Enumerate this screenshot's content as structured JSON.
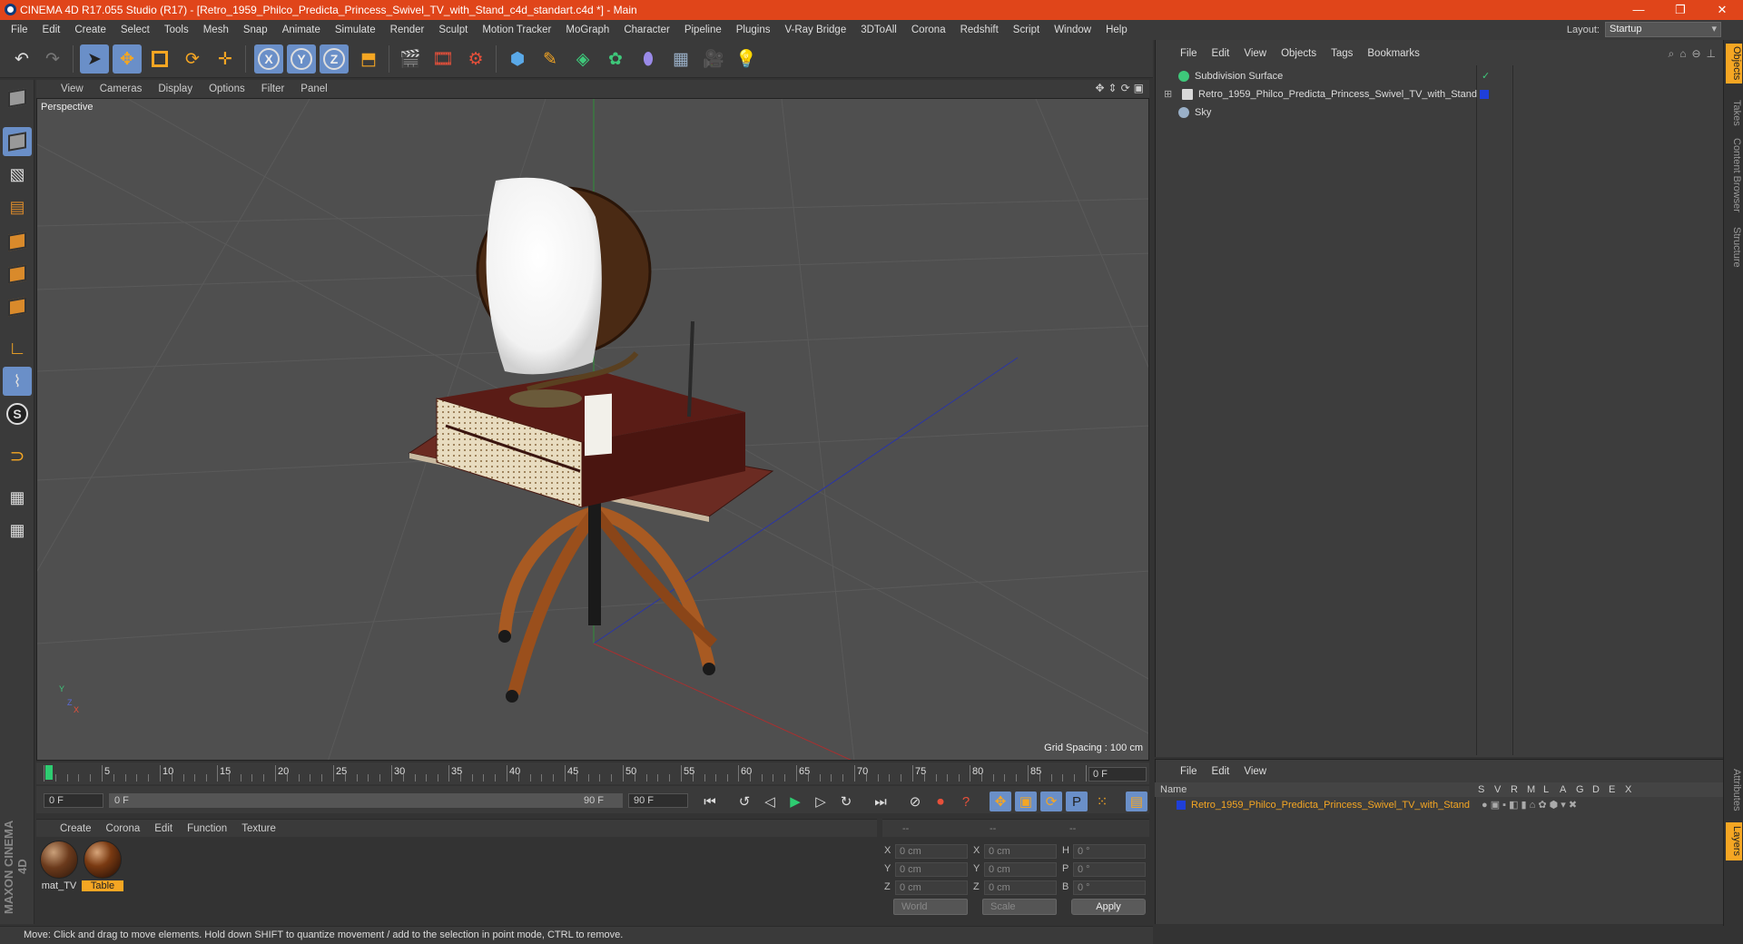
{
  "window": {
    "title": "CINEMA 4D R17.055 Studio (R17) - [Retro_1959_Philco_Predicta_Princess_Swivel_TV_with_Stand_c4d_standart.c4d *] - Main",
    "controls": {
      "minimize": "—",
      "restore": "❐",
      "close": "✕"
    }
  },
  "menubar": {
    "items": [
      "File",
      "Edit",
      "Create",
      "Select",
      "Tools",
      "Mesh",
      "Snap",
      "Animate",
      "Simulate",
      "Render",
      "Sculpt",
      "Motion Tracker",
      "MoGraph",
      "Character",
      "Pipeline",
      "Plugins",
      "V-Ray Bridge",
      "3DToAll",
      "Corona",
      "Redshift",
      "Script",
      "Window",
      "Help"
    ],
    "layout_label": "Layout:",
    "layout_value": "Startup"
  },
  "toolbar": {
    "icons": [
      "undo-icon",
      "redo-icon",
      "select-arrow-icon",
      "move-icon",
      "scale-icon",
      "rotate-icon",
      "live-select-icon",
      "x-axis-icon",
      "y-axis-icon",
      "z-axis-icon",
      "coordinate-system-icon",
      "render-view-icon",
      "render-picture-viewer-icon",
      "render-settings-icon",
      "cube-icon",
      "pen-spline-icon",
      "subdivision-icon",
      "cloner-icon",
      "deformer-icon",
      "floor-icon",
      "camera-icon",
      "light-icon"
    ],
    "axis_labels": [
      "X",
      "Y",
      "Z"
    ],
    "accent_color": "#6a8fc8"
  },
  "left_tools": {
    "icons": [
      "make-editable-icon",
      "model-mode-icon",
      "texture-mode-icon",
      "workplane-icon",
      "points-mode-icon",
      "edges-mode-icon",
      "polygons-mode-icon",
      "axis-mode-icon",
      "tweak-mode-icon",
      "snap-s-icon",
      "magnet-icon",
      "workplane-lock-icon",
      "solo-icon"
    ],
    "brand": "MAXON CINEMA 4D"
  },
  "viewport": {
    "menu": [
      "View",
      "Cameras",
      "Display",
      "Options",
      "Filter",
      "Panel"
    ],
    "label": "Perspective",
    "grid_spacing": "Grid Spacing : 100 cm",
    "axis_labels": {
      "y": "Y",
      "z": "Z",
      "x": "X"
    }
  },
  "timeline": {
    "ticks": [
      "0",
      "5",
      "10",
      "15",
      "20",
      "25",
      "30",
      "35",
      "40",
      "45",
      "50",
      "55",
      "60",
      "65",
      "70",
      "75",
      "80",
      "85",
      "90"
    ],
    "current_frame": "0 F",
    "start_field": "0 F",
    "range_start": "0 F",
    "range_end": "90 F",
    "end_field": "90 F"
  },
  "material_manager": {
    "menu": [
      "Create",
      "Corona",
      "Edit",
      "Function",
      "Texture"
    ],
    "materials": [
      {
        "name": "mat_TV",
        "selected": false
      },
      {
        "name": "Table",
        "selected": true
      }
    ]
  },
  "coordinates": {
    "headers": [
      "--",
      "--",
      "--"
    ],
    "rows": [
      {
        "a_label": "X",
        "a_value": "0 cm",
        "b_label": "X",
        "b_value": "0 cm",
        "c_label": "H",
        "c_value": "0 °"
      },
      {
        "a_label": "Y",
        "a_value": "0 cm",
        "b_label": "Y",
        "b_value": "0 cm",
        "c_label": "P",
        "c_value": "0 °"
      },
      {
        "a_label": "Z",
        "a_value": "0 cm",
        "b_label": "Z",
        "b_value": "0 cm",
        "c_label": "B",
        "c_value": "0 °"
      }
    ],
    "space_dropdown": "World",
    "mode_dropdown": "Scale",
    "apply_label": "Apply"
  },
  "status_bar": {
    "text": "Move: Click and drag to move elements. Hold down SHIFT to quantize movement / add to the selection in point mode, CTRL to remove."
  },
  "object_manager": {
    "menu": [
      "File",
      "Edit",
      "View",
      "Objects",
      "Tags",
      "Bookmarks"
    ],
    "objects": [
      {
        "name": "Subdivision Surface",
        "icon_color": "#3ec87a",
        "check": "✓"
      },
      {
        "name": "Retro_1959_Philco_Predicta_Princess_Swivel_TV_with_Stand",
        "icon_color": "#d9d9d9",
        "tag_color": "#1f3fd9"
      },
      {
        "name": "Sky",
        "icon_color": "#9ab0c8"
      }
    ]
  },
  "layer_manager": {
    "menu": [
      "File",
      "Edit",
      "View"
    ],
    "header_name": "Name",
    "header_flags": [
      "S",
      "V",
      "R",
      "M",
      "L",
      "A",
      "G",
      "D",
      "E",
      "X"
    ],
    "layers": [
      {
        "name": "Retro_1959_Philco_Predicta_Princess_Swivel_TV_with_Stand",
        "color": "#1f3fd9"
      }
    ],
    "name_color": "#f5a623"
  },
  "side_tabs": [
    "Objects",
    "Takes",
    "Content Browser",
    "Structure"
  ],
  "side_tabs_bottom": [
    "Attributes",
    "Layers"
  ]
}
